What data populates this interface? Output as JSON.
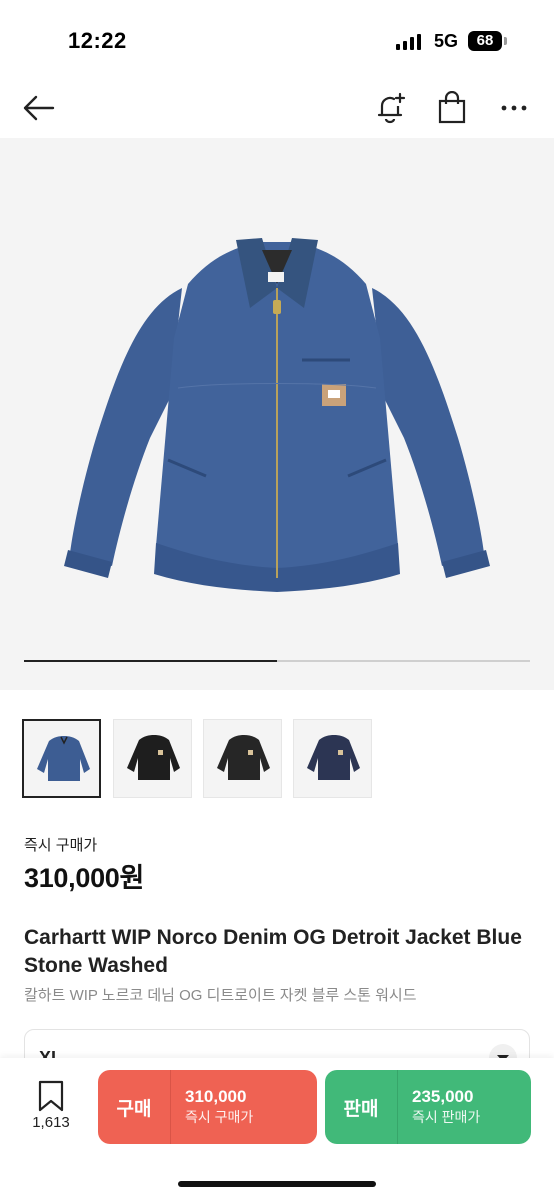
{
  "status_bar": {
    "time": "12:22",
    "network": "5G",
    "battery": "68"
  },
  "header": {
    "icons": [
      "back-arrow-icon",
      "notification-add-icon",
      "shopping-bag-icon",
      "more-icon"
    ]
  },
  "gallery": {
    "progress": 0.5,
    "thumbnails": [
      {
        "name": "blue-denim-jacket",
        "color": "#3d5d93"
      },
      {
        "name": "black-jacket",
        "color": "#1e1e1e"
      },
      {
        "name": "black-jacket-alt",
        "color": "#262626"
      },
      {
        "name": "navy-jacket",
        "color": "#2c3553"
      }
    ]
  },
  "product": {
    "price_label": "즉시 구매가",
    "price": "310,000원",
    "title_en": "Carhartt WIP Norco Denim OG Detroit Jacket Blue Stone Washed",
    "title_ko": "칼하트 WIP 노르코 데님 OG 디트로이트 자켓 블루 스톤 워시드"
  },
  "size_selector": {
    "value": "XL"
  },
  "bottom_bar": {
    "wish_count": "1,613",
    "buy": {
      "label": "구매",
      "price": "310,000",
      "sub": "즉시 구매가",
      "color": "#ef6253"
    },
    "sell": {
      "label": "판매",
      "price": "235,000",
      "sub": "즉시 판매가",
      "color": "#41b979"
    }
  }
}
